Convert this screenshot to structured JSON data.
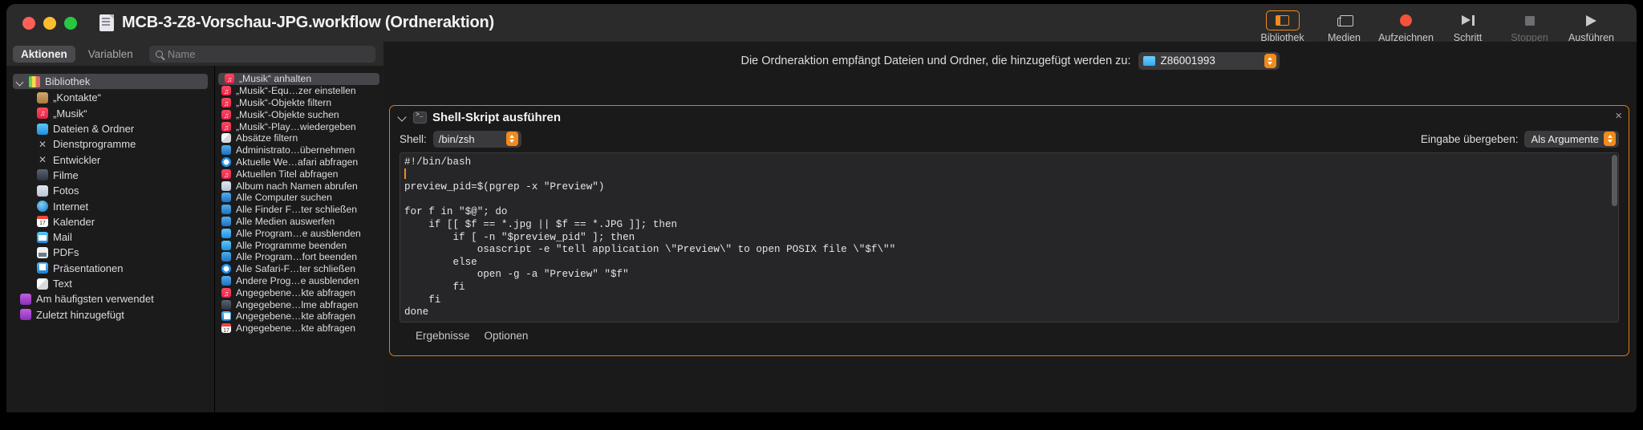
{
  "window": {
    "title": "MCB-3-Z8-Vorschau-JPG.workflow (Ordneraktion)",
    "doc_icon": "document-icon"
  },
  "toolbar": {
    "buttons": [
      {
        "label": "Bibliothek",
        "icon": "library-icon",
        "state": "selected"
      },
      {
        "label": "Medien",
        "icon": "media-icon",
        "state": "normal"
      },
      {
        "label": "Aufzeichnen",
        "icon": "record-icon",
        "state": "normal"
      },
      {
        "label": "Schritt",
        "icon": "step-icon",
        "state": "normal"
      },
      {
        "label": "Stoppen",
        "icon": "stop-icon",
        "state": "disabled"
      },
      {
        "label": "Ausführen",
        "icon": "play-icon",
        "state": "normal"
      }
    ]
  },
  "left_panel": {
    "tabs": [
      {
        "label": "Aktionen",
        "active": true
      },
      {
        "label": "Variablen",
        "active": false
      }
    ],
    "search": {
      "placeholder": "Name",
      "value": "",
      "icon": "search-icon"
    },
    "library": [
      {
        "label": "Bibliothek",
        "icon": "books-icon",
        "level": "header"
      },
      {
        "label": "„Kontakte“",
        "icon": "contacts-icon",
        "level": "child"
      },
      {
        "label": "„Musik“",
        "icon": "music-icon",
        "level": "child"
      },
      {
        "label": "Dateien & Ordner",
        "icon": "finder-icon",
        "level": "child"
      },
      {
        "label": "Dienstprogramme",
        "icon": "utilities-icon",
        "level": "child"
      },
      {
        "label": "Entwickler",
        "icon": "utilities-icon",
        "level": "child"
      },
      {
        "label": "Filme",
        "icon": "movies-icon",
        "level": "child"
      },
      {
        "label": "Fotos",
        "icon": "photos-icon",
        "level": "child"
      },
      {
        "label": "Internet",
        "icon": "internet-icon",
        "level": "child"
      },
      {
        "label": "Kalender",
        "icon": "calendar-icon",
        "level": "child"
      },
      {
        "label": "Mail",
        "icon": "mail-icon",
        "level": "child"
      },
      {
        "label": "PDFs",
        "icon": "pdf-icon",
        "level": "child"
      },
      {
        "label": "Präsentationen",
        "icon": "presentation-icon",
        "level": "child"
      },
      {
        "label": "Text",
        "icon": "text-icon",
        "level": "child"
      },
      {
        "label": "Am häufigsten verwendet",
        "icon": "purple-folder-icon",
        "level": "root"
      },
      {
        "label": "Zuletzt hinzugefügt",
        "icon": "purple-folder-icon",
        "level": "root"
      }
    ],
    "actions": [
      {
        "label": "„Musik“ anhalten",
        "icon": "music-icon",
        "selected": true
      },
      {
        "label": "„Musik“-Equ…zer einstellen",
        "icon": "music-icon",
        "selected": false
      },
      {
        "label": "„Musik“-Objekte filtern",
        "icon": "music-icon",
        "selected": false
      },
      {
        "label": "„Musik“-Objekte suchen",
        "icon": "music-icon",
        "selected": false
      },
      {
        "label": "„Musik“-Play…wiedergeben",
        "icon": "music-icon",
        "selected": false
      },
      {
        "label": "Absätze filtern",
        "icon": "text-icon",
        "selected": false
      },
      {
        "label": "Administrato…übernehmen",
        "icon": "sysprefs-icon",
        "selected": false
      },
      {
        "label": "Aktuelle We…afari abfragen",
        "icon": "safari-icon",
        "selected": false
      },
      {
        "label": "Aktuellen Titel abfragen",
        "icon": "music-icon",
        "selected": false
      },
      {
        "label": "Album nach Namen abrufen",
        "icon": "photos-icon",
        "selected": false
      },
      {
        "label": "Alle Computer suchen",
        "icon": "sysprefs-icon",
        "selected": false
      },
      {
        "label": "Alle Finder F…ter schließen",
        "icon": "sysprefs-icon",
        "selected": false
      },
      {
        "label": "Alle Medien auswerfen",
        "icon": "sysprefs-icon",
        "selected": false
      },
      {
        "label": "Alle Program…e ausblenden",
        "icon": "finder-icon",
        "selected": false
      },
      {
        "label": "Alle Programme beenden",
        "icon": "finder-icon",
        "selected": false
      },
      {
        "label": "Alle Program…fort beenden",
        "icon": "sysprefs-icon",
        "selected": false
      },
      {
        "label": "Alle Safari-F…ter schließen",
        "icon": "safari-icon",
        "selected": false
      },
      {
        "label": "Andere Prog…e ausblenden",
        "icon": "sysprefs-icon",
        "selected": false
      },
      {
        "label": "Angegebene…kte abfragen",
        "icon": "music-icon",
        "selected": false
      },
      {
        "label": "Angegebene…lme abfragen",
        "icon": "movies-icon",
        "selected": false
      },
      {
        "label": "Angegebene…kte abfragen",
        "icon": "presentation-icon",
        "selected": false
      },
      {
        "label": "Angegebene…kte abfragen",
        "icon": "calendar-icon",
        "selected": false
      }
    ]
  },
  "workflow": {
    "folder_banner": {
      "text": "Die Ordneraktion empfängt Dateien und Ordner, die hinzugefügt werden zu:",
      "folder_icon": "folder-icon",
      "folder_name": "Z86001993",
      "stepper_icon": "stepper-icon"
    },
    "action": {
      "title": "Shell-Skript ausführen",
      "icon": "terminal-icon",
      "disclosure_icon": "chevron-down-icon",
      "close_icon": "close-icon",
      "shell_label": "Shell:",
      "shell_value": "/bin/zsh",
      "input_label": "Eingabe übergeben:",
      "input_value": "Als Argumente",
      "script": "#!/bin/bash\n\npreview_pid=$(pgrep -x \"Preview\")\n\nfor f in \"$@\"; do\n    if [[ $f == *.jpg || $f == *.JPG ]]; then\n        if [ -n \"$preview_pid\" ]; then\n            osascript -e \"tell application \\\"Preview\\\" to open POSIX file \\\"$f\\\"\"\n        else\n            open -g -a \"Preview\" \"$f\"\n        fi\n    fi\ndone",
      "footer_tabs": [
        {
          "label": "Ergebnisse"
        },
        {
          "label": "Optionen"
        }
      ]
    }
  },
  "colors": {
    "accent_orange": "#e07b10",
    "selection_gray": "#46464a",
    "window_bg": "#2b2b2b",
    "panel_bg": "#1b1b1b",
    "code_bg": "#262628"
  }
}
